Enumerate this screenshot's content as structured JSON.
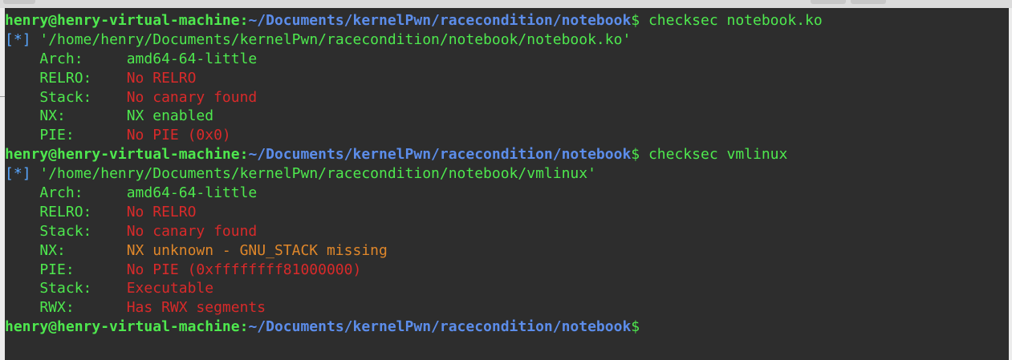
{
  "terminal": {
    "prompt": {
      "user_host": "henry@henry-virtual-machine",
      "colon": ":",
      "path": "~/Documents/kernelPwn/racecondition/notebook",
      "dollar": "$"
    },
    "blocks": [
      {
        "command": " checksec notebook.ko",
        "info_open": "[",
        "info_star": "*",
        "info_close": "]",
        "info_text": " '/home/henry/Documents/kernelPwn/racecondition/notebook/notebook.ko'",
        "rows": [
          {
            "key": "    Arch:     ",
            "value": "amd64-64-little",
            "status": "good"
          },
          {
            "key": "    RELRO:    ",
            "value": "No RELRO",
            "status": "bad"
          },
          {
            "key": "    Stack:    ",
            "value": "No canary found",
            "status": "bad"
          },
          {
            "key": "    NX:       ",
            "value": "NX enabled",
            "status": "good"
          },
          {
            "key": "    PIE:      ",
            "value": "No PIE (0x0)",
            "status": "bad"
          }
        ]
      },
      {
        "command": " checksec vmlinux",
        "info_open": "[",
        "info_star": "*",
        "info_close": "]",
        "info_text": " '/home/henry/Documents/kernelPwn/racecondition/notebook/vmlinux'",
        "rows": [
          {
            "key": "    Arch:     ",
            "value": "amd64-64-little",
            "status": "good"
          },
          {
            "key": "    RELRO:    ",
            "value": "No RELRO",
            "status": "bad"
          },
          {
            "key": "    Stack:    ",
            "value": "No canary found",
            "status": "bad"
          },
          {
            "key": "    NX:       ",
            "value": "NX unknown - GNU_STACK missing",
            "status": "warn"
          },
          {
            "key": "    PIE:      ",
            "value": "No PIE (0xffffffff81000000)",
            "status": "bad"
          },
          {
            "key": "    Stack:    ",
            "value": "Executable",
            "status": "bad"
          },
          {
            "key": "    RWX:      ",
            "value": "Has RWX segments",
            "status": "bad"
          }
        ]
      }
    ]
  },
  "colors": {
    "background": "#2d2d2d",
    "green": "#4ee84e",
    "blue_path": "#5c8dea",
    "red": "#d92a2a",
    "orange": "#e0872a"
  }
}
